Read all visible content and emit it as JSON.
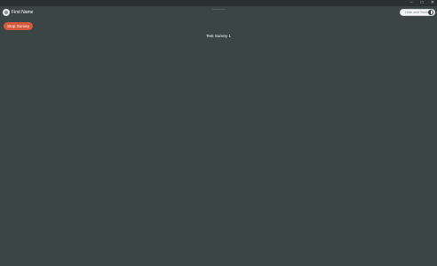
{
  "window": {
    "controls": {
      "minimize_icon": "minimize-icon",
      "maximize_icon": "maximize-icon",
      "close_icon": "close-icon",
      "minimize_glyph": "–",
      "maximize_glyph": "□",
      "close_glyph": "✕"
    }
  },
  "header": {
    "user_name": "First Name",
    "avatar_icon": "avatar-icon",
    "toggle": {
      "label": "Hide and Seek",
      "state": "on"
    }
  },
  "actions": {
    "stop_label": "Stop Survey"
  },
  "main": {
    "survey_title": "Test Survey 1"
  },
  "colors": {
    "background": "#3b4546",
    "titlebar": "#2b3132",
    "stop_button": "#d35a3a"
  }
}
